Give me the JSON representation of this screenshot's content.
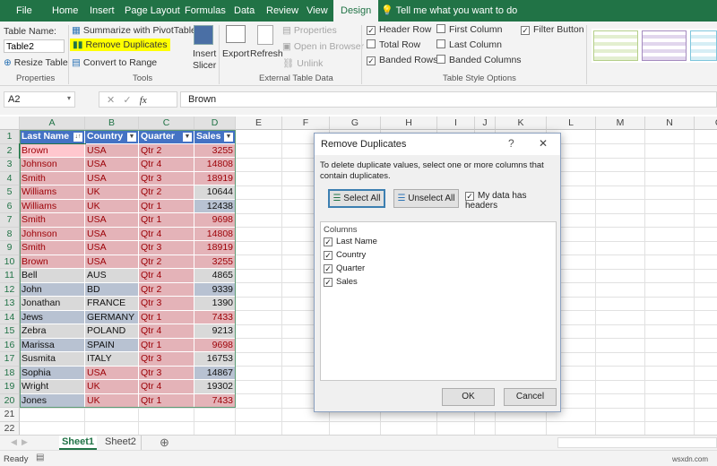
{
  "tabs": [
    "File",
    "Home",
    "Insert",
    "Page Layout",
    "Formulas",
    "Data",
    "Review",
    "View",
    "Design"
  ],
  "tell_me": "Tell me what you want to do",
  "ribbon": {
    "table_name_label": "Table Name:",
    "table_name_value": "Table2",
    "resize_table": "Resize Table",
    "properties_group": "Properties",
    "summarize_pivot": "Summarize with PivotTable",
    "remove_duplicates": "Remove Duplicates",
    "convert_range": "Convert to Range",
    "insert_slicer_1": "Insert",
    "insert_slicer_2": "Slicer",
    "tools_group": "Tools",
    "export": "Export",
    "refresh": "Refresh",
    "properties": "Properties",
    "open_browser": "Open in Browser",
    "unlink": "Unlink",
    "external_group": "External Table Data",
    "header_row": "Header Row",
    "total_row": "Total Row",
    "banded_rows": "Banded Rows",
    "first_column": "First Column",
    "last_column": "Last Column",
    "banded_columns": "Banded Columns",
    "filter_button": "Filter Button",
    "style_options_group": "Table Style Options",
    "checks": {
      "header_row": true,
      "total_row": false,
      "banded_rows": true,
      "first_column": false,
      "last_column": false,
      "banded_columns": false,
      "filter_button": true
    }
  },
  "formula_bar": {
    "name_box": "A2",
    "fx": "fx",
    "value": "Brown"
  },
  "columns": [
    "A",
    "B",
    "C",
    "D",
    "E",
    "F",
    "G",
    "H",
    "I",
    "J",
    "K",
    "L",
    "M",
    "N",
    "O"
  ],
  "table": {
    "headers": [
      "Last Name",
      "Country",
      "Quarter",
      "Sales"
    ],
    "rows": [
      {
        "c": [
          "Brown",
          "USA",
          "Qtr 2",
          "3255"
        ],
        "dup": [
          1,
          1,
          1,
          1
        ]
      },
      {
        "c": [
          "Johnson",
          "USA",
          "Qtr 4",
          "14808"
        ],
        "dup": [
          1,
          1,
          1,
          1
        ]
      },
      {
        "c": [
          "Smith",
          "USA",
          "Qtr 3",
          "18919"
        ],
        "dup": [
          1,
          1,
          1,
          1
        ]
      },
      {
        "c": [
          "Williams",
          "UK",
          "Qtr 2",
          "10644"
        ],
        "dup": [
          1,
          1,
          1,
          0
        ]
      },
      {
        "c": [
          "Williams",
          "UK",
          "Qtr 1",
          "12438"
        ],
        "dup": [
          1,
          1,
          1,
          0
        ]
      },
      {
        "c": [
          "Smith",
          "USA",
          "Qtr 1",
          "9698"
        ],
        "dup": [
          1,
          1,
          1,
          1
        ]
      },
      {
        "c": [
          "Johnson",
          "USA",
          "Qtr 4",
          "14808"
        ],
        "dup": [
          1,
          1,
          1,
          1
        ]
      },
      {
        "c": [
          "Smith",
          "USA",
          "Qtr 3",
          "18919"
        ],
        "dup": [
          1,
          1,
          1,
          1
        ]
      },
      {
        "c": [
          "Brown",
          "USA",
          "Qtr 2",
          "3255"
        ],
        "dup": [
          1,
          1,
          1,
          1
        ]
      },
      {
        "c": [
          "Bell",
          "AUS",
          "Qtr 4",
          "4865"
        ],
        "dup": [
          0,
          0,
          1,
          0
        ]
      },
      {
        "c": [
          "John",
          "BD",
          "Qtr 2",
          "9339"
        ],
        "dup": [
          0,
          0,
          1,
          0
        ]
      },
      {
        "c": [
          "Jonathan",
          "FRANCE",
          "Qtr 3",
          "1390"
        ],
        "dup": [
          0,
          0,
          1,
          0
        ]
      },
      {
        "c": [
          "Jews",
          "GERMANY",
          "Qtr 1",
          "7433"
        ],
        "dup": [
          0,
          0,
          1,
          1
        ]
      },
      {
        "c": [
          "Zebra",
          "POLAND",
          "Qtr 4",
          "9213"
        ],
        "dup": [
          0,
          0,
          1,
          0
        ]
      },
      {
        "c": [
          "Marissa",
          "SPAIN",
          "Qtr 1",
          "9698"
        ],
        "dup": [
          0,
          0,
          1,
          1
        ]
      },
      {
        "c": [
          "Susmita",
          "ITALY",
          "Qtr 3",
          "16753"
        ],
        "dup": [
          0,
          0,
          1,
          0
        ]
      },
      {
        "c": [
          "Sophia",
          "USA",
          "Qtr 3",
          "14867"
        ],
        "dup": [
          0,
          1,
          1,
          0
        ]
      },
      {
        "c": [
          "Wright",
          "UK",
          "Qtr 4",
          "19302"
        ],
        "dup": [
          0,
          1,
          1,
          0
        ]
      },
      {
        "c": [
          "Jones",
          "UK",
          "Qtr 1",
          "7433"
        ],
        "dup": [
          0,
          1,
          1,
          1
        ]
      }
    ]
  },
  "dialog": {
    "title": "Remove Duplicates",
    "help": "?",
    "close": "✕",
    "instructions": "To delete duplicate values, select one or more columns that contain duplicates.",
    "select_all": "Select All",
    "unselect_all": "Unselect All",
    "has_headers": "My data has headers",
    "columns_label": "Columns",
    "columns": [
      "Last Name",
      "Country",
      "Quarter",
      "Sales"
    ],
    "ok": "OK",
    "cancel": "Cancel"
  },
  "sheets": [
    "Sheet1",
    "Sheet2"
  ],
  "active_sheet": "Sheet1",
  "status": "Ready",
  "watermark": "wsxdn.com",
  "colors": {
    "excel_green": "#217346",
    "dup_fill": "#e4b3b8",
    "dup_text": "#9c0006",
    "header_fill": "#4472c4",
    "highlight": "#ffff00"
  }
}
